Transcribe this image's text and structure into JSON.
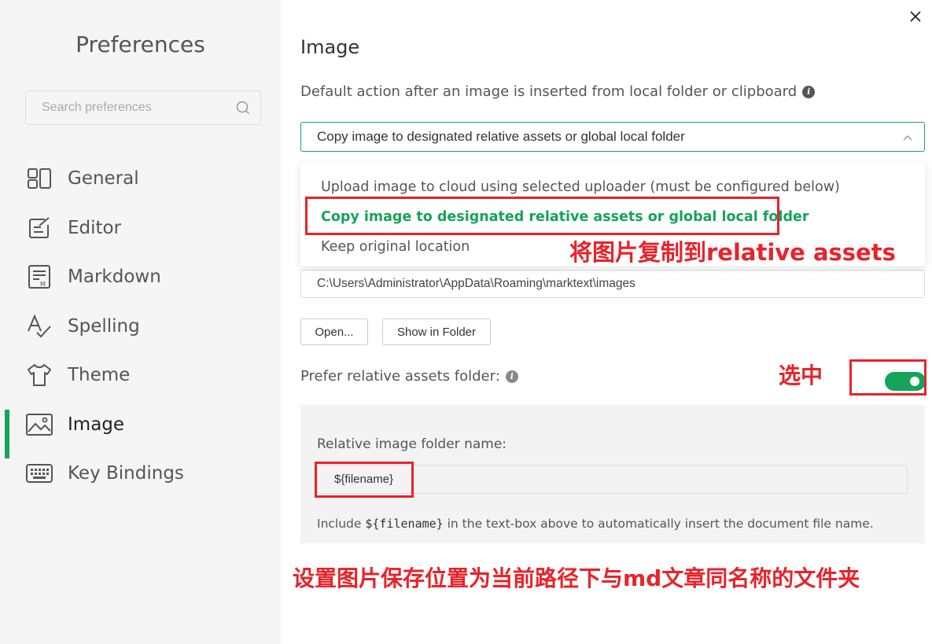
{
  "sidebar": {
    "title": "Preferences",
    "search_placeholder": "Search preferences",
    "items": [
      {
        "label": "General",
        "icon": "general-icon"
      },
      {
        "label": "Editor",
        "icon": "editor-icon"
      },
      {
        "label": "Markdown",
        "icon": "markdown-icon"
      },
      {
        "label": "Spelling",
        "icon": "spelling-icon"
      },
      {
        "label": "Theme",
        "icon": "theme-icon"
      },
      {
        "label": "Image",
        "icon": "image-icon",
        "active": true
      },
      {
        "label": "Key Bindings",
        "icon": "keyboard-icon"
      }
    ]
  },
  "main": {
    "title": "Image",
    "insert_action_label": "Default action after an image is inserted from local folder or clipboard",
    "select_value": "Copy image to designated relative assets or global local folder",
    "options": [
      "Upload image to cloud using selected uploader (must be configured below)",
      "Copy image to designated relative assets or global local folder",
      "Keep original location"
    ],
    "global_folder_path": "C:\\Users\\Administrator\\AppData\\Roaming\\marktext\\images",
    "open_button": "Open...",
    "show_in_folder_button": "Show in Folder",
    "prefer_relative_label": "Prefer relative assets folder:",
    "prefer_relative_enabled": true,
    "relative_folder_label": "Relative image folder name:",
    "relative_folder_value": "${filename}",
    "hint_before": "Include ",
    "hint_code": "${filename}",
    "hint_after": " in the text-box above to automatically insert the document file name."
  },
  "annotations": {
    "copy_note": "将图片复制到relative assets",
    "selected_note": "选中",
    "bottom_note": "设置图片保存位置为当前路径下与md文章同名称的文件夹",
    "color": "#e8232a"
  },
  "colors": {
    "accent": "#16a35a",
    "sidebar_bg": "#f5f5f5"
  }
}
